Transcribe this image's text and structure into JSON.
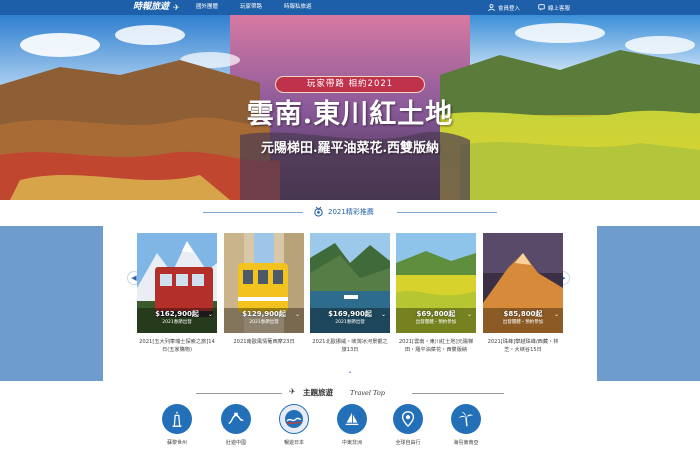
{
  "header": {
    "logo": "時報旅遊",
    "nav": [
      "國外團體",
      "玩家帶路",
      "時報私旅遊"
    ],
    "tools": [
      "會員登入",
      "線上客服"
    ]
  },
  "hero": {
    "pill": "玩家帶路 相約2021",
    "title": "雲南.東川紅土地",
    "subtitle": "元陽梯田.羅平油菜花.西雙版納"
  },
  "featured": {
    "title": "2021精彩推薦",
    "prev": "◀",
    "next": "▶",
    "toggle": "⌃",
    "cards": [
      {
        "price": "$162,900起",
        "tag": "2021春節出發",
        "text": "2021[五大列車瑞士探索之旅]14日(五家購物)"
      },
      {
        "price": "$129,900起",
        "tag": "2021春節出發",
        "text": "2021南歐風情葡西摩23日"
      },
      {
        "price": "$169,900起",
        "tag": "2021春節出發",
        "text": "2021北歐挪威・峽灣冰河景觀之旅13日"
      },
      {
        "price": "$69,800起",
        "tag": "出發團體・預約參加",
        "text": "2021[雲南・東川紅土地]元陽梯田・羅平油菜花・西雙版納"
      },
      {
        "price": "$85,800起",
        "tag": "出發團體・預約參加",
        "text": "2021[珠峰]攀越珠峰/西藏・林芝・大峽谷15日"
      }
    ]
  },
  "theme": {
    "title": "主題旅遊",
    "subtitle": "Travel Top",
    "items": [
      "蘇黎世州",
      "壯遊中國",
      "暢遊日本",
      "中東非洲",
      "全球自由行",
      "海島東南亞"
    ]
  },
  "colors": {
    "nav_bg": "#1d5fa8",
    "accent_blue": "#2470b8",
    "band_blue": "#6e9ccd",
    "pill_red": "#c0314c"
  }
}
